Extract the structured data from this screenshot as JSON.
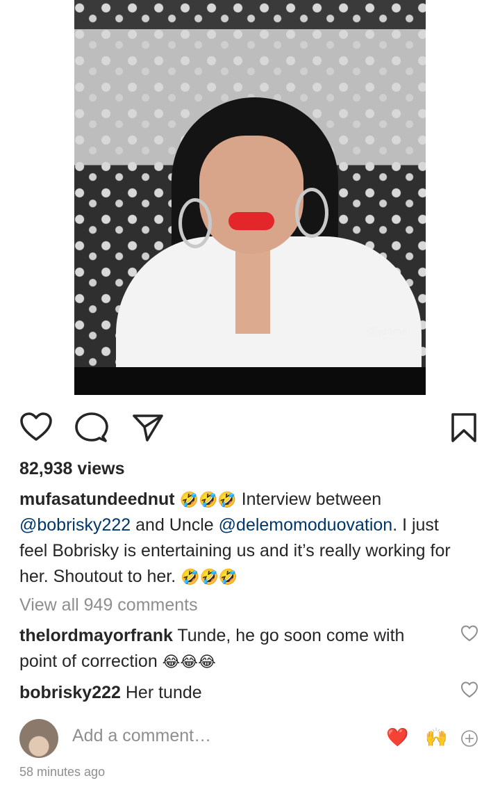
{
  "video": {
    "watermark": "@ijeoma"
  },
  "actions": {
    "like_icon": "heart-outline-icon",
    "comment_icon": "speech-bubble-icon",
    "share_icon": "paper-plane-icon",
    "save_icon": "bookmark-icon"
  },
  "post": {
    "views": "82,938 views",
    "author": "mufasatundeednut",
    "caption_emojis_lead": "🤣🤣🤣",
    "caption_text_1": " Interview between ",
    "mention_1": "@bobrisky222",
    "caption_text_2": " and Uncle ",
    "mention_2": "@delemomoduovation",
    "caption_text_3": ". I just feel Bobrisky is entertaining us and it’s really working for her. Shoutout to her. ",
    "caption_emojis_tail": "🤣🤣🤣",
    "view_all_comments": "View all 949 comments"
  },
  "comments": [
    {
      "username": "thelordmayorfrank",
      "text": " Tunde, he go soon come with point of correction ",
      "emojis": "😂😂😂"
    },
    {
      "username": "bobrisky222",
      "text": " Her tunde",
      "emojis": ""
    }
  ],
  "add_comment": {
    "placeholder": "Add a comment…",
    "quick_emoji_1": "❤️",
    "quick_emoji_2": "🙌",
    "add_icon": "plus-circle-icon"
  },
  "timestamp": "58 minutes ago",
  "colors": {
    "text": "#262626",
    "muted": "#8e8e8e",
    "mention": "#00376b",
    "heart_red": "#ed4956"
  }
}
